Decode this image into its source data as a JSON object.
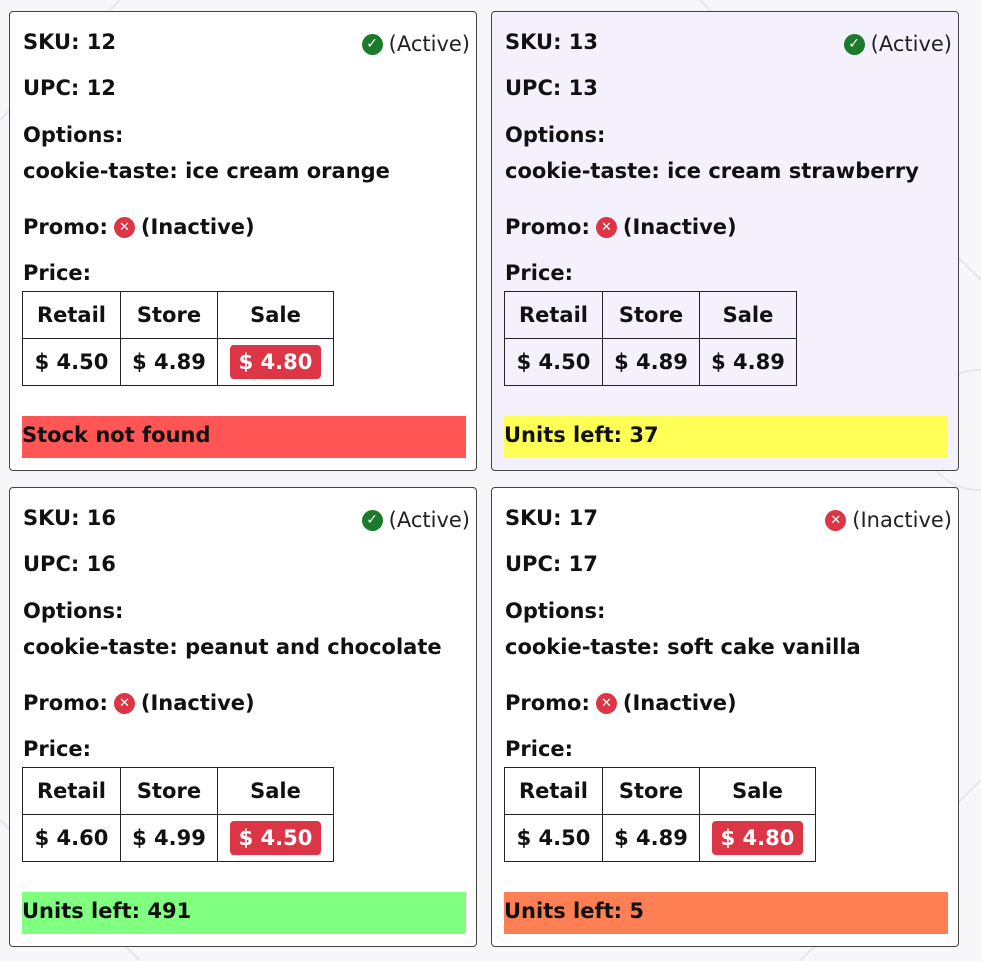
{
  "labels": {
    "sku": "SKU:",
    "upc": "UPC:",
    "options": "Options:",
    "promo": "Promo:",
    "price": "Price:",
    "retail": "Retail",
    "store": "Store",
    "sale": "Sale"
  },
  "cards": [
    {
      "status": "(Active)",
      "status_icon": "check-circle-icon",
      "sku": "12",
      "upc": "12",
      "option": "cookie-taste: ice cream orange",
      "promo": "(Inactive)",
      "retail": "$ 4.50",
      "store": "$ 4.89",
      "sale": "$ 4.80",
      "sale_highlight": true,
      "stock": "Stock not found",
      "stock_color": "#ff5555"
    },
    {
      "status": "(Active)",
      "status_icon": "check-circle-icon",
      "sku": "13",
      "upc": "13",
      "option": "cookie-taste: ice cream strawberry",
      "promo": "(Inactive)",
      "retail": "$ 4.50",
      "store": "$ 4.89",
      "sale": "$ 4.89",
      "sale_highlight": false,
      "stock": "Units left: 37",
      "stock_color": "#ffff55"
    },
    {
      "status": "(Active)",
      "status_icon": "check-circle-icon",
      "sku": "16",
      "upc": "16",
      "option": "cookie-taste: peanut and chocolate",
      "promo": "(Inactive)",
      "retail": "$ 4.60",
      "store": "$ 4.99",
      "sale": "$ 4.50",
      "sale_highlight": true,
      "stock": "Units left: 491",
      "stock_color": "#80ff80"
    },
    {
      "status": "(Inactive)",
      "status_icon": "x-circle-icon",
      "sku": "17",
      "upc": "17",
      "option": "cookie-taste: soft cake vanilla",
      "promo": "(Inactive)",
      "retail": "$ 4.50",
      "store": "$ 4.89",
      "sale": "$ 4.80",
      "sale_highlight": true,
      "stock": "Units left: 5",
      "stock_color": "#ff7f55"
    }
  ],
  "colors": {
    "active": "#1c7a2b",
    "inactive": "#dc3545",
    "selected_card_bg": "#f4f1fd"
  }
}
